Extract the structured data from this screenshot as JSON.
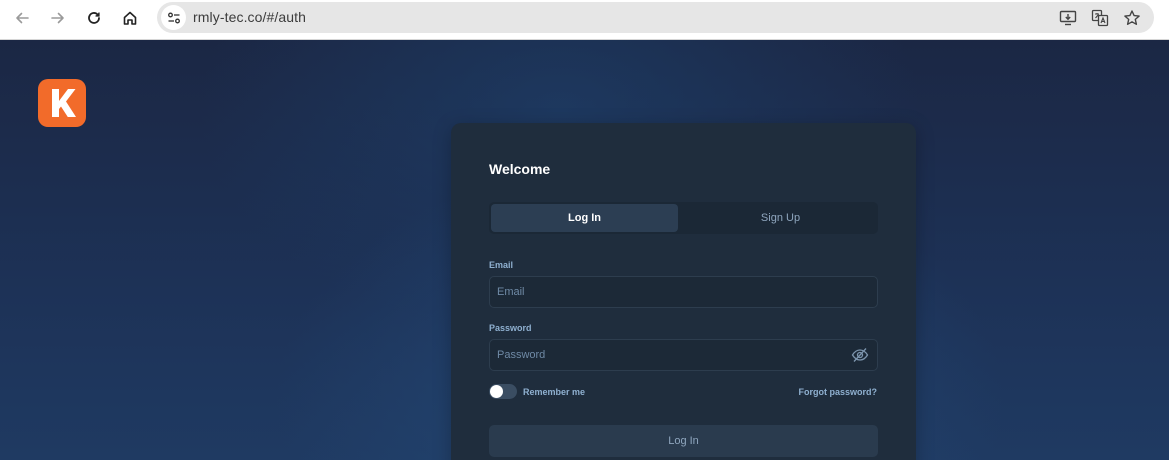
{
  "browser": {
    "url": "rmly-tec.co/#/auth",
    "buttons": [
      "back-icon",
      "forward-icon",
      "reload-icon",
      "home-icon"
    ],
    "omnibox_icons": [
      "install-app-icon",
      "translate-icon",
      "bookmark-star-icon"
    ]
  },
  "auth": {
    "title": "Welcome",
    "tabs": [
      {
        "label": "Log In",
        "active": true
      },
      {
        "label": "Sign Up",
        "active": false
      }
    ],
    "email": {
      "label": "Email",
      "placeholder": "Email",
      "value": ""
    },
    "password": {
      "label": "Password",
      "placeholder": "Password",
      "value": ""
    },
    "remember_me": {
      "label": "Remember me",
      "checked": false
    },
    "forgot_password": "Forgot password?",
    "submit_label": "Log In"
  },
  "colors": {
    "brand": "#f26b2a",
    "card": "#1f2d3d",
    "label": "#8fb0d0",
    "background": "#1d3257"
  }
}
